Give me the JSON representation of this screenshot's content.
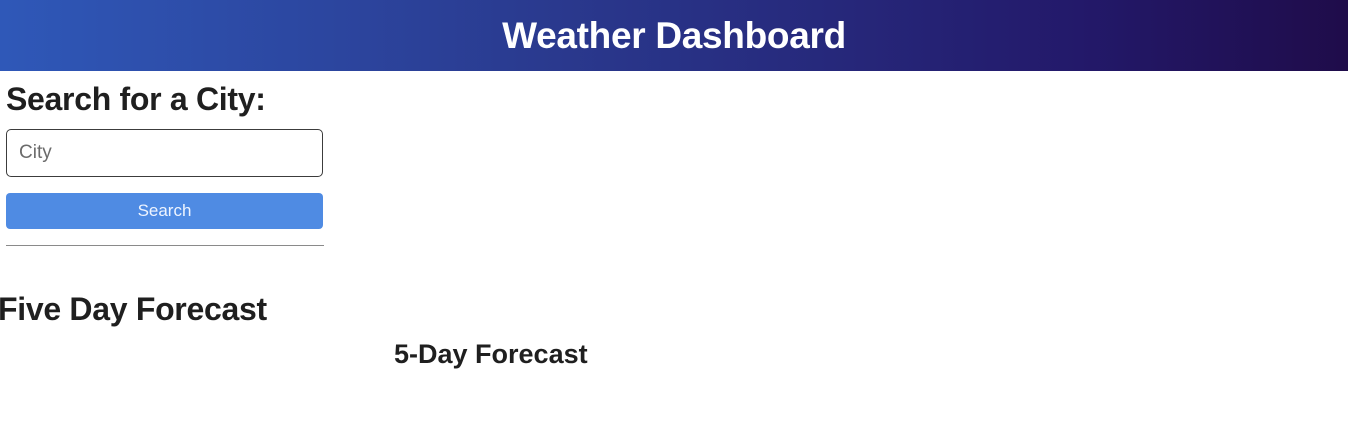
{
  "header": {
    "title": "Weather Dashboard"
  },
  "search": {
    "title": "Search for a City:",
    "input_placeholder": "City",
    "input_value": "",
    "button_label": "Search"
  },
  "forecast": {
    "section_title": "Five Day Forecast",
    "subtitle": "5-Day Forecast"
  },
  "colors": {
    "header_gradient_start": "#2f58b8",
    "header_gradient_end": "#1f0c4a",
    "button_bg": "#4f8be3",
    "text": "#1f1f1f"
  }
}
